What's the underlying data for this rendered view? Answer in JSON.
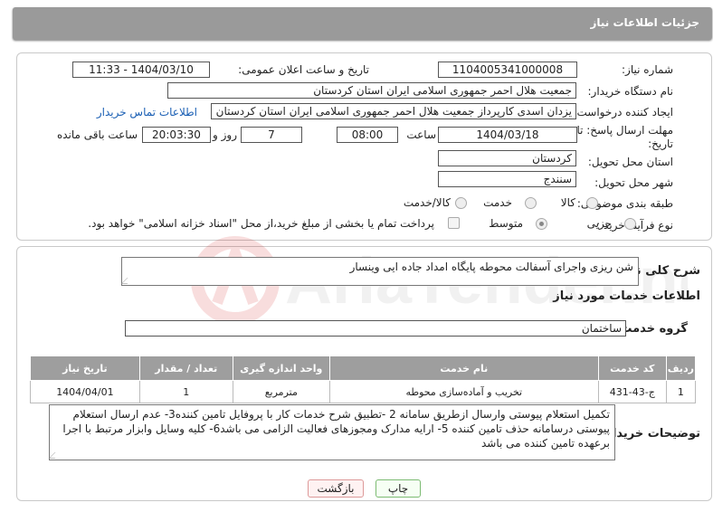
{
  "header": {
    "title": "جزئیات اطلاعات نیاز"
  },
  "labels": {
    "need_number": "شماره نیاز:",
    "announce_datetime": "تاریخ و ساعت اعلان عمومی:",
    "buyer_org": "نام دستگاه خریدار:",
    "requester": "ایجاد کننده درخواست:",
    "deadline": "مهلت ارسال پاسخ: تا تاریخ:",
    "time_label": "ساعت",
    "days_label": "روز و",
    "remaining_label": "ساعت باقی مانده",
    "province": "استان محل تحویل:",
    "city": "شهر محل تحویل:",
    "category": "طبقه بندی موضوعی:",
    "process_type": "نوع فرآیند خرید :",
    "general_desc": "شرح کلی نیاز:",
    "services_info": "اطلاعات خدمات مورد نیاز",
    "service_group": "گروه خدمت:",
    "buyer_notes": "توضیحات خریدار:"
  },
  "values": {
    "need_number": "1104005341000008",
    "announce_datetime": "1404/03/10 - 11:33",
    "buyer_org": "جمعیت هلال احمر جمهوری اسلامی ایران استان کردستان",
    "requester": "یزدان اسدی کارپرداز جمعیت هلال احمر جمهوری اسلامی ایران استان کردستان",
    "contact_link": "اطلاعات تماس خریدار",
    "deadline_date": "1404/03/18",
    "deadline_time": "08:00",
    "days": "7",
    "remaining_time": "20:03:30",
    "province": "کردستان",
    "city": "سنندج",
    "general_desc": "شن ریزی واجرای آسفالت محوطه پایگاه امداد جاده ایی وینسار",
    "service_group": "ساختمان",
    "buyer_notes": "تکمیل استعلام پیوستی وارسال ازطریق سامانه 2 -تطبیق شرح خدمات کار با پروفایل تامین کننده3- عدم ارسال استعلام پیوستی درسامانه حذف تامین کننده 5- ارایه مدارک ومجوزهای فعالیت الزامی می باشد6- کلیه وسایل وابزار مرتبط با اجرا برعهده تامین کننده می باشد"
  },
  "category_options": [
    {
      "label": "کالا",
      "checked": false
    },
    {
      "label": "خدمت",
      "checked": false
    },
    {
      "label": "کالا/خدمت",
      "checked": false
    }
  ],
  "process_options": [
    {
      "label": "جزیی",
      "checked": false
    },
    {
      "label": "متوسط",
      "checked": true
    }
  ],
  "payment_note": "پرداخت تمام یا بخشی از مبلغ خرید،از محل \"اسناد خزانه اسلامی\" خواهد بود.",
  "table": {
    "headers": [
      "ردیف",
      "کد خدمت",
      "نام خدمت",
      "واحد اندازه گیری",
      "تعداد / مقدار",
      "تاریخ نیاز"
    ],
    "rows": [
      [
        "1",
        "ج-43-431",
        "تخریب و آماده‌سازی محوطه",
        "مترمربع",
        "1",
        "1404/04/01"
      ]
    ]
  },
  "buttons": {
    "print": "چاپ",
    "back": "بازگشت"
  },
  "watermark": "AriaTender.net"
}
